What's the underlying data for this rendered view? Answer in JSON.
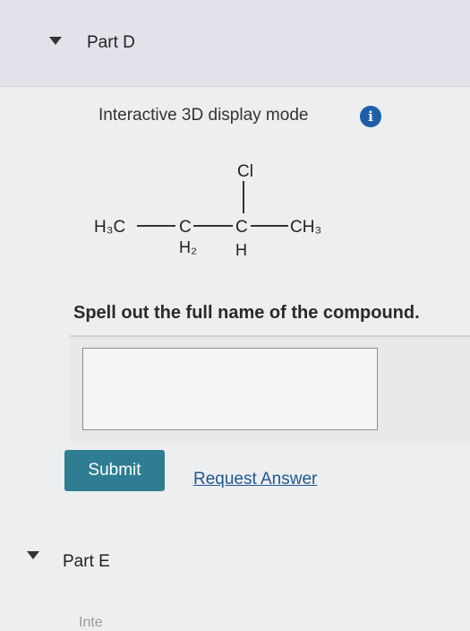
{
  "part_d": {
    "title": "Part D"
  },
  "display_mode": {
    "label": "Interactive 3D display mode",
    "info_glyph": "i"
  },
  "structure": {
    "chlorine": "Cl",
    "methyl_left": "H₃C",
    "carbon": "C",
    "h2": "H₂",
    "h": "H",
    "methyl_right": "CH₃"
  },
  "question": {
    "prompt": "Spell out the full name of the compound."
  },
  "answer": {
    "value": ""
  },
  "actions": {
    "submit_label": "Submit",
    "request_label": "Request Answer"
  },
  "part_e": {
    "title": "Part E",
    "next_hint": "Inte"
  },
  "colors": {
    "accent": "#2e7d92",
    "link": "#24578f",
    "info": "#1f5fa8"
  }
}
